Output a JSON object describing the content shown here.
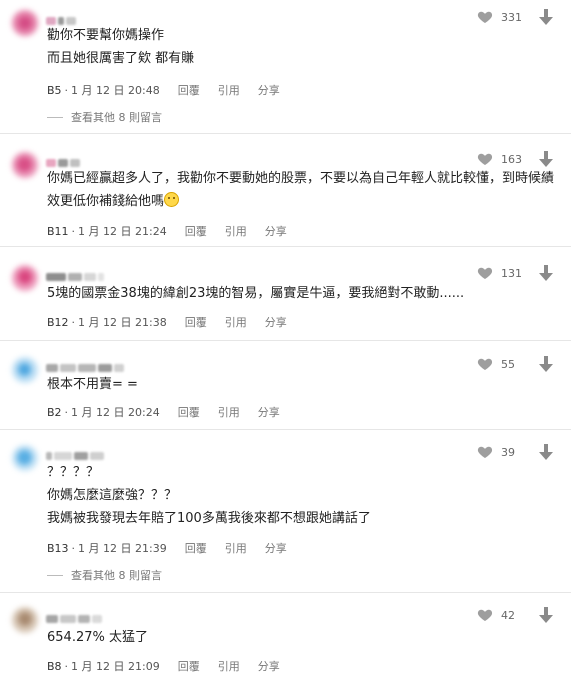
{
  "colors": {
    "like_icon": "#9e9e9e",
    "text": "#222222",
    "meta": "#777777",
    "divider": "#e6e6e6"
  },
  "icons": {
    "like": "heart-icon",
    "dislike": "arrow-down-icon",
    "emoji": "slightly-smiling-face-emoji"
  },
  "comments": [
    {
      "likes": "331",
      "lines": [
        "勸你不要幫你媽操作",
        "而且她很厲害了欸 都有賺"
      ],
      "floor": "B5",
      "sep": "·",
      "datetime": "1 月 12 日 20:48",
      "reply": "回覆",
      "quote": "引用",
      "share": "分享",
      "more": "查看其他 8 則留言"
    },
    {
      "likes": "163",
      "lines": [
        "你媽已經贏超多人了，我勸你不要動她的股票，不要以為自己年輕人就比較懂，到時候績",
        "效更低你補錢給他嗎"
      ],
      "floor": "B11",
      "sep": "·",
      "datetime": "1 月 12 日 21:24",
      "reply": "回覆",
      "quote": "引用",
      "share": "分享"
    },
    {
      "likes": "131",
      "lines": [
        "5塊的國票金38塊的緯創23塊的智易，屬實是牛逼，要我絕對不敢動......"
      ],
      "floor": "B12",
      "sep": "·",
      "datetime": "1 月 12 日 21:38",
      "reply": "回覆",
      "quote": "引用",
      "share": "分享"
    },
    {
      "likes": "55",
      "lines": [
        "根本不用賣= ="
      ],
      "floor": "B2",
      "sep": "·",
      "datetime": "1 月 12 日 20:24",
      "reply": "回覆",
      "quote": "引用",
      "share": "分享"
    },
    {
      "likes": "39",
      "lines": [
        "？？？？",
        "你媽怎麼這麼強？？？",
        "我媽被我發現去年賠了100多萬我後來都不想跟她講話了"
      ],
      "floor": "B13",
      "sep": "·",
      "datetime": "1 月 12 日 21:39",
      "reply": "回覆",
      "quote": "引用",
      "share": "分享",
      "more": "查看其他 8 則留言"
    },
    {
      "likes": "42",
      "lines": [
        "654.27% 太猛了"
      ],
      "floor": "B8",
      "sep": "·",
      "datetime": "1 月 12 日 21:09",
      "reply": "回覆",
      "quote": "引用",
      "share": "分享"
    }
  ]
}
